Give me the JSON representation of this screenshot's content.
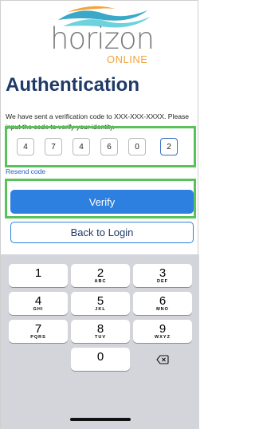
{
  "brand": {
    "name": "horizon",
    "sub": "ONLINE"
  },
  "title": "Authentication",
  "description": "We have sent a verification code to XXX-XXX-XXXX. Please input the code to verify your identity.",
  "code_digits": [
    "4",
    "7",
    "4",
    "6",
    "0",
    "2"
  ],
  "resend_label": "Resend code",
  "verify_label": "Verify",
  "back_label": "Back to Login",
  "keyboard": {
    "k1": {
      "num": "1",
      "letters": ""
    },
    "k2": {
      "num": "2",
      "letters": "ABC"
    },
    "k3": {
      "num": "3",
      "letters": "DEF"
    },
    "k4": {
      "num": "4",
      "letters": "GHI"
    },
    "k5": {
      "num": "5",
      "letters": "JKL"
    },
    "k6": {
      "num": "6",
      "letters": "MNO"
    },
    "k7": {
      "num": "7",
      "letters": "PQRS"
    },
    "k8": {
      "num": "8",
      "letters": "TUV"
    },
    "k9": {
      "num": "9",
      "letters": "WXYZ"
    },
    "k0": {
      "num": "0",
      "letters": ""
    }
  },
  "colors": {
    "title": "#1f3a67",
    "primary": "#2d7fe0",
    "highlight": "#59c25a",
    "logo_orange": "#f2a43a",
    "logo_teal": "#3aa8c8",
    "keyboard_bg": "#d3d5db"
  },
  "icons": {
    "delete_key": "backspace-icon",
    "logo_wave": "wave-icon"
  }
}
